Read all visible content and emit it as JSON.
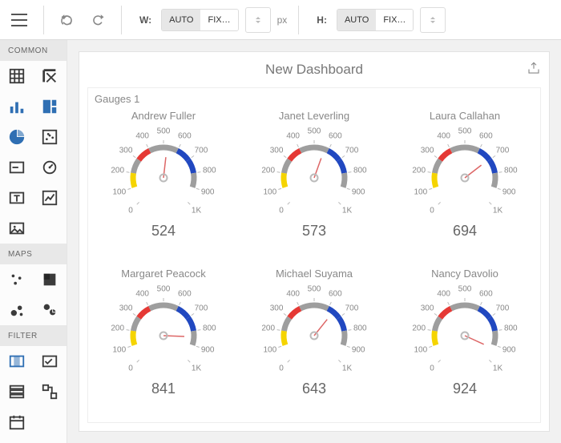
{
  "toolbar": {
    "menu_icon": "hamburger",
    "width_label": "W:",
    "height_label": "H:",
    "unit": "px",
    "seg_auto": "AUTO",
    "seg_fixed": "FIX…",
    "width_mode_selected": "AUTO",
    "height_mode_selected": "AUTO"
  },
  "sidebar": {
    "groups": [
      {
        "label": "COMMON",
        "items": [
          {
            "name": "grid",
            "color": "#3b3b3b"
          },
          {
            "name": "pivot",
            "color": "#3b3b3b"
          },
          {
            "name": "bar-chart",
            "color": "#2f6fb3"
          },
          {
            "name": "treemap",
            "color": "#2f6fb3"
          },
          {
            "name": "pie",
            "color": "#2f6fb3"
          },
          {
            "name": "scatter",
            "color": "#3b3b3b"
          },
          {
            "name": "card",
            "color": "#3b3b3b"
          },
          {
            "name": "gauge",
            "color": "#3b3b3b"
          },
          {
            "name": "text",
            "color": "#3b3b3b"
          },
          {
            "name": "range",
            "color": "#3b3b3b"
          },
          {
            "name": "image",
            "color": "#3b3b3b"
          }
        ]
      },
      {
        "label": "MAPS",
        "items": [
          {
            "name": "geo-point",
            "color": "#3b3b3b"
          },
          {
            "name": "choropleth",
            "color": "#3b3b3b"
          },
          {
            "name": "bubble-map",
            "color": "#3b3b3b"
          },
          {
            "name": "pie-map",
            "color": "#3b3b3b"
          }
        ]
      },
      {
        "label": "FILTER",
        "items": [
          {
            "name": "range-filter",
            "color": "#2f6fb3"
          },
          {
            "name": "combo-filter",
            "color": "#3b3b3b"
          },
          {
            "name": "list-filter",
            "color": "#3b3b3b"
          },
          {
            "name": "tree-filter",
            "color": "#3b3b3b"
          },
          {
            "name": "date-filter",
            "color": "#3b3b3b"
          }
        ]
      }
    ]
  },
  "dashboard": {
    "title": "New Dashboard",
    "panel_title": "Gauges 1",
    "export_icon": "export"
  },
  "chart_data": {
    "type": "gauge",
    "min": 0,
    "max": 1000,
    "ticks": [
      0,
      100,
      200,
      300,
      400,
      500,
      600,
      700,
      800,
      900,
      1000
    ],
    "tick_labels": [
      "0",
      "100",
      "200",
      "300",
      "400",
      "500",
      "600",
      "700",
      "800",
      "900",
      "1K"
    ],
    "color_ranges": [
      {
        "from": 100,
        "to": 200,
        "color": "#f5d400"
      },
      {
        "from": 200,
        "to": 300,
        "color": "#9e9e9e"
      },
      {
        "from": 300,
        "to": 400,
        "color": "#e53935"
      },
      {
        "from": 400,
        "to": 500,
        "color": "#9e9e9e"
      },
      {
        "from": 500,
        "to": 600,
        "color": "#9e9e9e"
      },
      {
        "from": 600,
        "to": 700,
        "color": "#2148c0"
      },
      {
        "from": 700,
        "to": 800,
        "color": "#2148c0"
      },
      {
        "from": 800,
        "to": 900,
        "color": "#9e9e9e"
      }
    ],
    "series": [
      {
        "name": "Andrew Fuller",
        "value": 524
      },
      {
        "name": "Janet Leverling",
        "value": 573
      },
      {
        "name": "Laura Callahan",
        "value": 694
      },
      {
        "name": "Margaret Peacock",
        "value": 841
      },
      {
        "name": "Michael Suyama",
        "value": 643
      },
      {
        "name": "Nancy Davolio",
        "value": 924
      }
    ]
  }
}
